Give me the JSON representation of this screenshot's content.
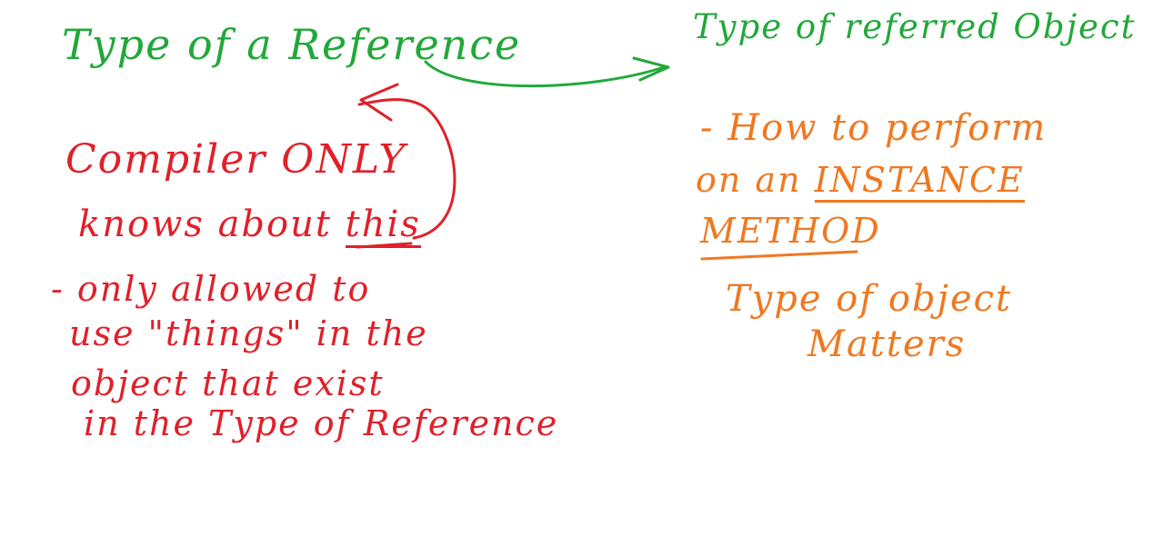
{
  "colors": {
    "green_ink": "#22a83a",
    "red_ink": "#e0202a",
    "orange_ink": "#f07820",
    "background": "#ffffff"
  },
  "left_heading": "Type of a Reference",
  "right_heading": "Type of referred Object",
  "compiler_note": {
    "line1": "Compiler ONLY",
    "line2_prefix": "knows about",
    "line2_emphasis": "this",
    "rule1_prefix": "- only allowed to",
    "rule2": "use \"things\" in the",
    "rule3": "object that exist",
    "rule4": "in the Type of Reference"
  },
  "instance_note": {
    "line1": "- How to perform",
    "line2_prefix": "on an",
    "line2_emphasis": "INSTANCE",
    "line3": "METHOD"
  },
  "matters_note": {
    "line1": "Type of object",
    "line2": "Matters"
  }
}
